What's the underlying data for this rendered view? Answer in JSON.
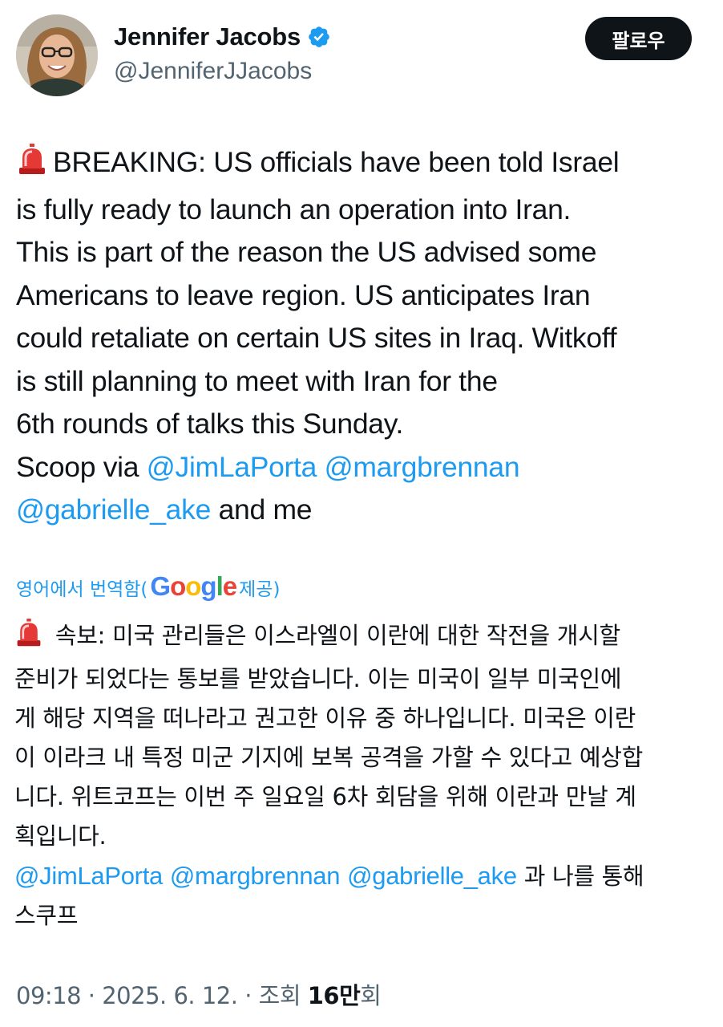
{
  "profile": {
    "display_name": "Jennifer Jacobs",
    "handle": "@JenniferJJacobs",
    "follow_label": "팔로우"
  },
  "tweet": {
    "lines": [
      "BREAKING: US officials have been told Israel",
      "is fully ready to launch an operation into Iran.",
      "This is part of the reason the US advised some",
      "Americans to leave region. US anticipates Iran",
      "could retaliate on certain US sites in Iraq. Witkoff",
      "is still planning to meet with Iran for the",
      "6th rounds of talks this Sunday."
    ],
    "scoop_prefix": "Scoop via",
    "mentions": [
      "@JimLaPorta",
      "@margbrennan",
      "@gabrielle_ake"
    ],
    "scoop_suffix": "and me"
  },
  "translation": {
    "label_prefix": "영어에서 번역함(",
    "google_letters": [
      "G",
      "o",
      "o",
      "g",
      "l",
      "e"
    ],
    "label_suffix": "제공)",
    "lines": [
      "속보: 미국 관리들은 이스라엘이 이란에 대한 작전을 개시할",
      "준비가 되었다는 통보를 받았습니다. 이는 미국이 일부 미국인에",
      "게 해당 지역을 떠나라고 권고한 이유 중 하나입니다. 미국은 이란",
      "이 이라크 내 특정 미군 기지에 보복 공격을 가할 수 있다고 예상합",
      "니다. 위트코프는 이번 주 일요일 6차 회담을 위해 이란과 만날 계",
      "획입니다."
    ],
    "mentions": [
      "@JimLaPorta",
      "@margbrennan",
      "@gabrielle_ake"
    ],
    "scoop_suffix": "과 나를 통해",
    "scoop_last": "스쿠프"
  },
  "meta": {
    "time": "09:18",
    "sep": "·",
    "date": "2025. 6. 12.",
    "views_label": "조회",
    "views_number": "16만",
    "views_unit": "회"
  },
  "colors": {
    "link": "#1d9bf0",
    "verified": "#1d9bf0",
    "secondary_text": "#536471"
  },
  "icons": [
    "siren-emoji-icon",
    "verified-badge-icon"
  ]
}
